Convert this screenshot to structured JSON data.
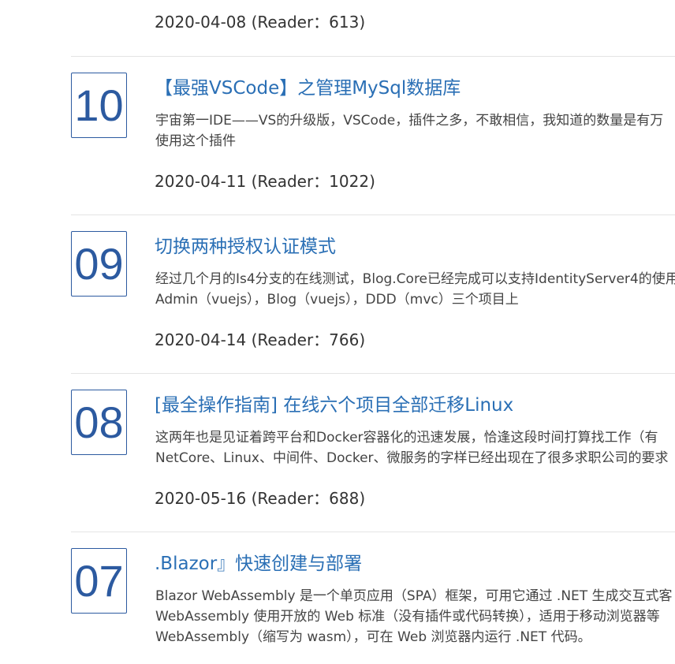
{
  "top_meta": "2020-04-08 (Reader：613)",
  "posts": [
    {
      "number": "10",
      "title": "【最强VSCode】之管理MySql数据库",
      "summary_lines": [
        "宇宙第一IDE——VS的升级版，VSCode，插件之多，不敢相信，我知道的数量是有万",
        "使用这个插件"
      ],
      "meta": "2020-04-11 (Reader：1022)"
    },
    {
      "number": "09",
      "title": "切换两种授权认证模式",
      "summary_lines": [
        "经过几个月的Is4分支的在线测试，Blog.Core已经完成可以支持IdentityServer4的使用",
        "Admin（vuejs），Blog（vuejs），DDD（mvc）三个项目上"
      ],
      "meta": "2020-04-14 (Reader：766)"
    },
    {
      "number": "08",
      "title": "[最全操作指南] 在线六个项目全部迁移Linux",
      "summary_lines": [
        "这两年也是见证着跨平台和Docker容器化的迅速发展，恰逢这段时间打算找工作（有",
        "NetCore、Linux、中间件、Docker、微服务的字样已经出现在了很多求职公司的要求"
      ],
      "meta": "2020-05-16 (Reader：688)"
    },
    {
      "number": "07",
      "title": ".Blazor』快速创建与部署",
      "summary_lines": [
        "Blazor WebAssembly 是一个单页应用（SPA）框架，可用它通过 .NET 生成交互式客",
        "WebAssembly 使用开放的 Web 标准（没有插件或代码转换），适用于移动浏览器等",
        "WebAssembly（缩写为 wasm），可在 Web 浏览器内运行 .NET 代码。"
      ],
      "meta": ""
    }
  ]
}
